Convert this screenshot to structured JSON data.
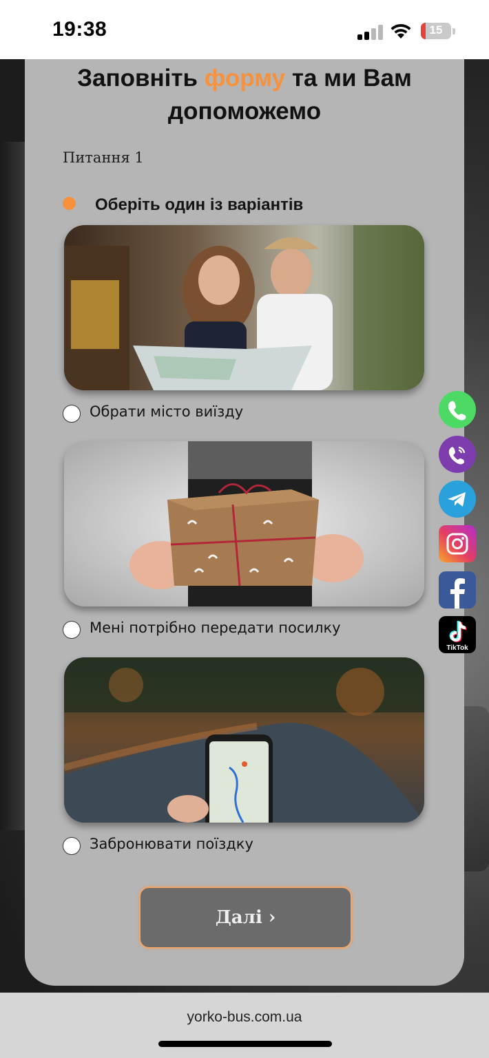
{
  "status_bar": {
    "time": "19:38",
    "battery_level": "15",
    "icons": [
      "signal-icon",
      "wifi-icon",
      "battery-charging-icon"
    ]
  },
  "form": {
    "title_part1": "Заповніть ",
    "title_accent": "форму",
    "title_part2": " та ми Вам",
    "title_line2": "допоможемо",
    "question_number": "Питання 1",
    "instruction": "Оберіть один із варіантів",
    "options": [
      {
        "label": "Обрати місто виїзду",
        "image": "travelers-with-map-photo",
        "selected": false
      },
      {
        "label": "Мені потрібно передати посилку",
        "image": "gift-parcel-photo",
        "selected": false
      },
      {
        "label": "Забронювати поїздку",
        "image": "phone-map-road-photo",
        "selected": false
      }
    ],
    "next_button": "Далі ›"
  },
  "social_links": [
    {
      "name": "phone",
      "icon": "phone-icon",
      "color": "#4cd964"
    },
    {
      "name": "viber",
      "icon": "viber-icon",
      "color": "#7d3daf"
    },
    {
      "name": "telegram",
      "icon": "telegram-icon",
      "color": "#2aa1da"
    },
    {
      "name": "instagram",
      "icon": "instagram-icon",
      "color": "#d6249f"
    },
    {
      "name": "facebook",
      "icon": "facebook-icon",
      "color": "#3b5998"
    },
    {
      "name": "tiktok",
      "icon": "tiktok-icon",
      "color": "#000000",
      "label": "TikTok"
    }
  ],
  "browser": {
    "url": "yorko-bus.com.ua"
  },
  "colors": {
    "accent": "#f7913b",
    "card": "#b5b5b5",
    "button": "#6b6b6b"
  }
}
